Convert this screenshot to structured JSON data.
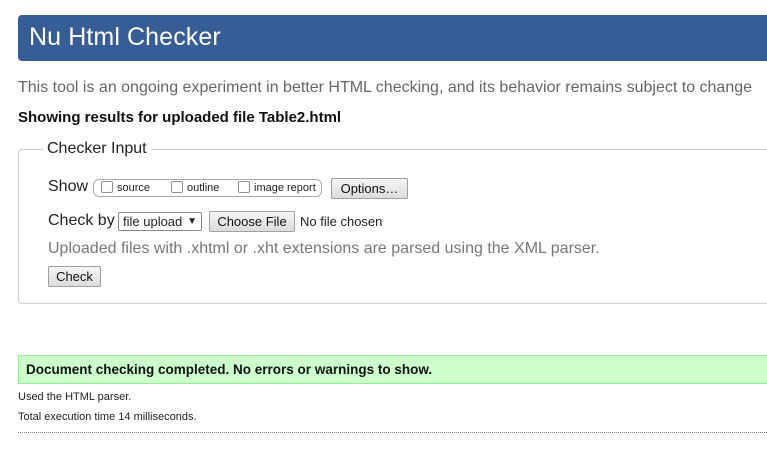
{
  "header": {
    "title": "Nu Html Checker"
  },
  "tagline": "This tool is an ongoing experiment in better HTML checking, and its behavior remains subject to change",
  "results_heading": "Showing results for uploaded file Table2.html",
  "checker_input": {
    "legend": "Checker Input",
    "show_label": "Show",
    "show_options": [
      {
        "label": "source",
        "checked": false
      },
      {
        "label": "outline",
        "checked": false
      },
      {
        "label": "image report",
        "checked": false
      }
    ],
    "options_button": "Options…",
    "check_by_label": "Check by",
    "check_by_selected": "file upload",
    "choose_file_button": "Choose File",
    "no_file_text": "No file chosen",
    "hint": "Uploaded files with .xhtml or .xht extensions are parsed using the XML parser.",
    "check_button": "Check"
  },
  "results": {
    "success_message": "Document checking completed. No errors or warnings to show.",
    "parser_info": "Used the HTML parser.",
    "execution_time": "Total execution time 14 milliseconds."
  },
  "colors": {
    "header_bg": "#365d95",
    "success_bg": "#ccffcc",
    "tagline_text": "#666666"
  }
}
